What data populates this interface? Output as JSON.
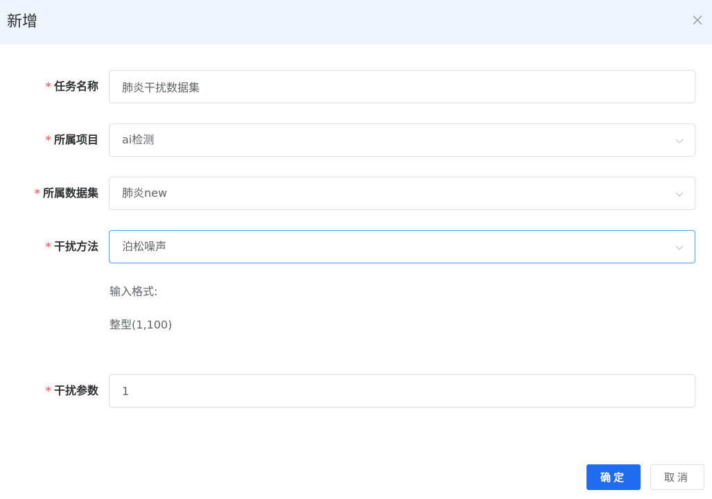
{
  "dialog": {
    "title": "新增",
    "close_icon": "close-icon"
  },
  "form": {
    "required_mark": "*",
    "task_name": {
      "label": "任务名称",
      "value": "肺炎干扰数据集"
    },
    "project": {
      "label": "所属项目",
      "value": "ai检测"
    },
    "dataset": {
      "label": "所属数据集",
      "value": "肺炎new"
    },
    "method": {
      "label": "干扰方法",
      "value": "泊松噪声"
    },
    "hint": {
      "format_label": "输入格式:",
      "format_value": "整型(1,100)"
    },
    "param": {
      "label": "干扰参数",
      "value": "1"
    }
  },
  "footer": {
    "confirm_label": "确定",
    "cancel_label": "取消"
  },
  "colors": {
    "header_bg": "#eef4fc",
    "required": "#f56c6c",
    "primary": "#1f6cf0",
    "focus_border": "#409eff"
  }
}
